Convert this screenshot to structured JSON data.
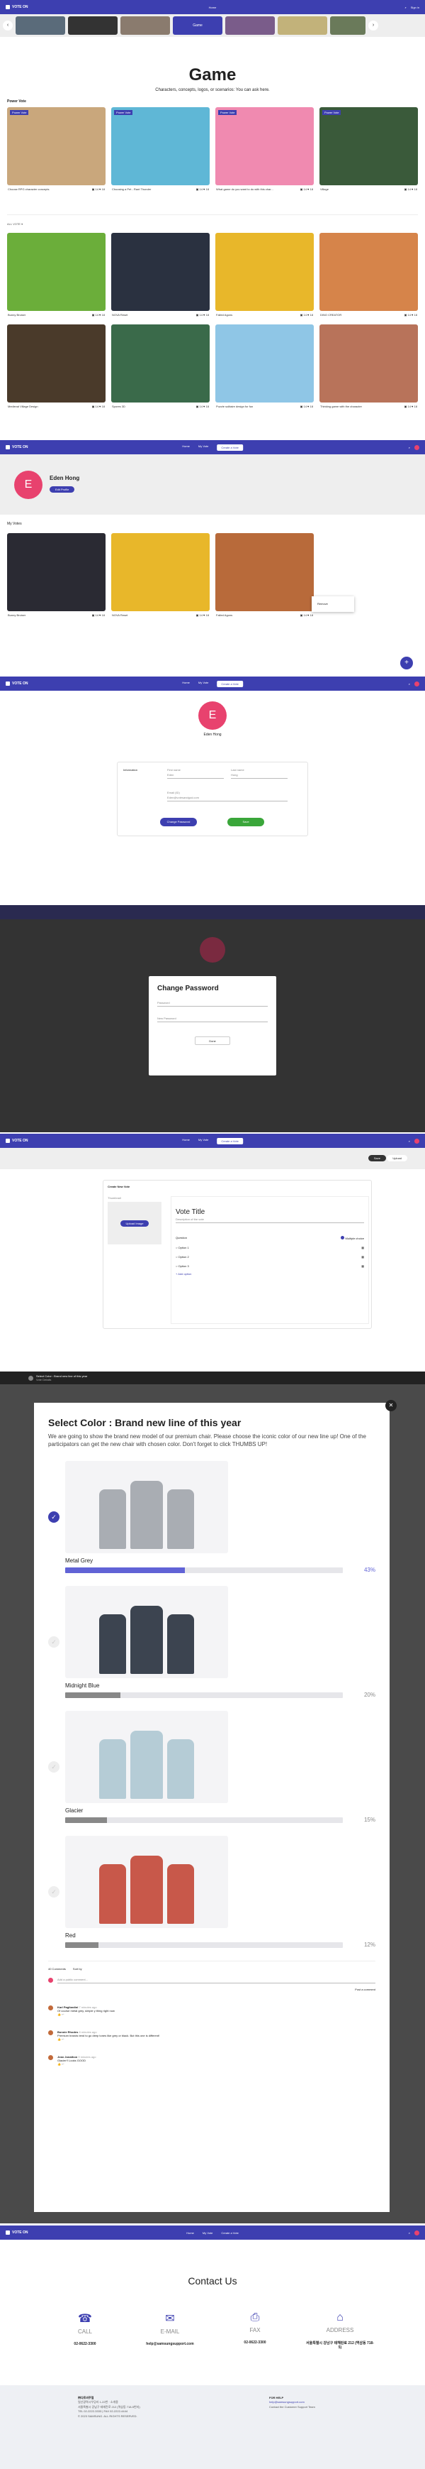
{
  "brand": {
    "name": "VOTE ON",
    "accent": "#3d3fb0",
    "pink": "#e8426e",
    "green": "#3aa63a"
  },
  "nav": {
    "home": "Home",
    "my_vote": "My Vote",
    "create": "Create a Vote",
    "signin": "Sign in"
  },
  "carousel": {
    "active_label": "Game"
  },
  "hero": {
    "title": "Game",
    "subtitle": "Characters, concepts, logos, or scenarios: You can ask here."
  },
  "power_vote": {
    "heading": "Power Vote",
    "tag": "Power Vote",
    "items": [
      {
        "title": "Choose RPG character concepts",
        "votes": "14",
        "likes": "18"
      },
      {
        "title": "Choosing a Pet - Rant Thunder",
        "votes": "14",
        "likes": "18"
      },
      {
        "title": "What game do you want to do with this char...",
        "votes": "14",
        "likes": "18"
      },
      {
        "title": "Village",
        "votes": "14",
        "likes": "18"
      }
    ]
  },
  "filter": {
    "label": "ALL VOTE"
  },
  "grid": [
    {
      "title": "Bunny Bruiser",
      "votes": "14",
      "likes": "18"
    },
    {
      "title": "NOVA Reset",
      "votes": "14",
      "likes": "18"
    },
    {
      "title": "Falled Agons",
      "votes": "14",
      "likes": "18"
    },
    {
      "title": "DINO CREATOR",
      "votes": "14",
      "likes": "18"
    },
    {
      "title": "Medieval Village Design",
      "votes": "14",
      "likes": "18"
    },
    {
      "title": "Spores 3D",
      "votes": "14",
      "likes": "18"
    },
    {
      "title": "Puzzle solitaire design for fun",
      "votes": "14",
      "likes": "18"
    },
    {
      "title": "Thinking game with the character",
      "votes": "14",
      "likes": "18"
    }
  ],
  "profile": {
    "name": "Eden Hong",
    "edit": "Edit Profile",
    "initial": "E",
    "my_votes": "My Votes",
    "items": [
      {
        "title": "Bunny Bruiser",
        "votes": "14",
        "likes": "18"
      },
      {
        "title": "NOVA Reset",
        "votes": "14",
        "likes": "18"
      },
      {
        "title": "Falled Agons",
        "votes": "14",
        "likes": "18"
      }
    ],
    "menu": "Remove"
  },
  "edit_profile": {
    "name": "Eden Hong",
    "info_label": "Information",
    "first_name": "First name",
    "first_value": "Eden",
    "last_name": "Last name",
    "last_value": "Hong",
    "email_label": "Email (ID)",
    "email_value": "Eden@votesandgod.com",
    "change_pw": "Change Password",
    "save": "Save"
  },
  "change_password": {
    "title": "Change Password",
    "current": "Password",
    "new_pw": "New Password",
    "done": "Done"
  },
  "create": {
    "chip1": "Save",
    "chip2": "Upload",
    "panel_title": "Create New Vote",
    "thumb_label": "Thumbnail",
    "upload": "Upload Image",
    "vote_title": "Vote Title",
    "desc": "Description of the vote",
    "question": "Question",
    "multiple": "Multiple choice",
    "options": [
      "Option 1",
      "Option 2",
      "Option 3"
    ],
    "add": "+ Add option"
  },
  "modal": {
    "header": "Select Color : Brand new line of this year",
    "sub": "Vote Details",
    "title": "Select Color : Brand new line of this year",
    "desc": "We are going to show the brand new model of our premium chair. Please choose the iconic color of our new line up! One of the participators can get the new chair with chosen color. Don't forget to click THUMBS UP!",
    "options": [
      {
        "name": "Metal Grey",
        "percent": "43%",
        "value": 0.43,
        "color": "#6163d6",
        "chair": "#a9adb3",
        "checked": true
      },
      {
        "name": "Midnight Blue",
        "percent": "20%",
        "value": 0.2,
        "color": "#888",
        "chair": "#3c4450",
        "checked": false
      },
      {
        "name": "Glacier",
        "percent": "15%",
        "value": 0.15,
        "color": "#888",
        "chair": "#b5ccd6",
        "checked": false
      },
      {
        "name": "Red",
        "percent": "12%",
        "value": 0.12,
        "color": "#888",
        "chair": "#c8584a",
        "checked": false
      }
    ],
    "comments_label": "40 Comments",
    "sort_label": "Sort by",
    "comment_placeholder": "Add a public comment...",
    "post": "Post a comment",
    "comments": [
      {
        "user": "Karl Pagliardini",
        "time": "7 minutes ago",
        "text": "Of course metal grey, simple y thing right now"
      },
      {
        "user": "Bonnie Rhodes",
        "time": "8 minutes ago",
        "text": "Premium brands tend to go deep tones like grey or black. But this one is different!"
      },
      {
        "user": "Jean Jonathon",
        "time": "9 minutes ago",
        "text": "Glacier!! Looks GOOD"
      }
    ]
  },
  "contact": {
    "title": "Contact Us",
    "items": [
      {
        "label": "CALL",
        "value": "02-0622-3300"
      },
      {
        "label": "E-MAIL",
        "value": "help@samsungsupport.com"
      },
      {
        "label": "FAX",
        "value": "02-0622-3300"
      },
      {
        "label": "ADDRESS",
        "value": "서울특별시 강남구 테헤란로 212 (역삼동 718-5)"
      }
    ]
  },
  "footer": {
    "company": "㈜다트비주얼",
    "line1": "일산광역시우당리 1-22번 · 소개용",
    "line2": "서울특별시 강남구 테헤란로 212 (역삼동 718-5번지)",
    "line3": "TEL 02-2222-3333 | FAX 02-2222-4444",
    "copy": "© 2023 SAMSUNG. ALL RIGHTS RESERVED.",
    "help": "FOR HELP",
    "help_mail": "help@samsungsupport.com",
    "help_line": "Contact the Customer Support Team"
  }
}
